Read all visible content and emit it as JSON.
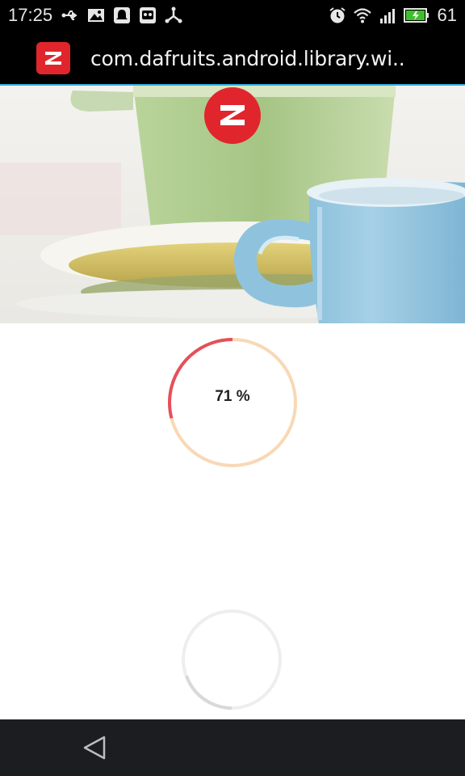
{
  "status_bar": {
    "time": "17:25",
    "battery_level": "61",
    "left_icons": [
      "usb-icon",
      "image-icon",
      "notification-bell-icon",
      "robot-face-icon",
      "share-network-icon"
    ],
    "right_icons": [
      "alarm-clock-icon",
      "wifi-icon",
      "cell-signal-3g-icon",
      "battery-charging-icon"
    ]
  },
  "app_bar": {
    "icon": "app-logo-icon",
    "title": "com.dafruits.android.library.wi.."
  },
  "hero": {
    "icon": "app-logo-icon"
  },
  "progress": {
    "value": 71,
    "label": "71 %",
    "colors": {
      "progress": "#e4505b",
      "track": "#f8d8b6"
    }
  },
  "spinner": {
    "colors": {
      "track": "#eeeeee",
      "arc": "#d9d9d9"
    }
  },
  "nav_bar": {
    "back_icon": "back-triangle-icon"
  },
  "colors": {
    "brand_red": "#e0262c",
    "accent_line": "#2fb4e6"
  }
}
